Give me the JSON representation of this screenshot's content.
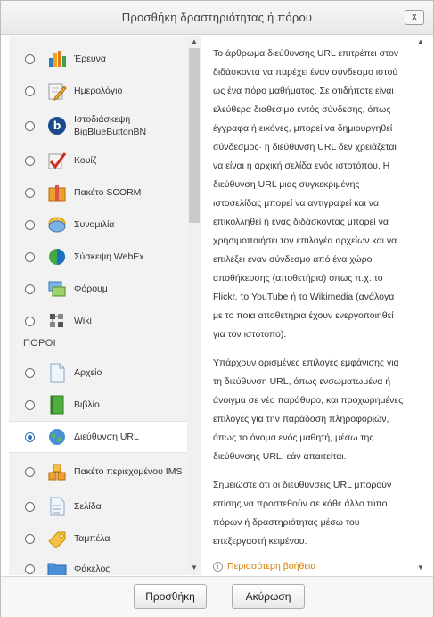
{
  "dialog": {
    "title": "Προσθήκη δραστηριότητας ή πόρου",
    "close_label": "x"
  },
  "activities": [
    {
      "label": "Έρευνα",
      "icon": "bar-chart-icon",
      "selected": false
    },
    {
      "label": "Ημερολόγιο",
      "icon": "journal-pencil-icon",
      "selected": false
    },
    {
      "label": "Ιστοδιάσκεψη BigBlueButtonBN",
      "icon": "bigbluebutton-icon",
      "selected": false
    },
    {
      "label": "Κουίζ",
      "icon": "quiz-checkmark-icon",
      "selected": false
    },
    {
      "label": "Πακέτο SCORM",
      "icon": "scorm-package-icon",
      "selected": false
    },
    {
      "label": "Συνομιλία",
      "icon": "chat-bubble-icon",
      "selected": false
    },
    {
      "label": "Σύσκεψη WebEx",
      "icon": "webex-icon",
      "selected": false
    },
    {
      "label": "Φόρουμ",
      "icon": "forum-icon",
      "selected": false
    },
    {
      "label": "Wiki",
      "icon": "wiki-icon",
      "selected": false
    }
  ],
  "resources_heading": "ΠΟΡΟΙ",
  "resources": [
    {
      "label": "Αρχείο",
      "icon": "file-icon",
      "selected": false
    },
    {
      "label": "Βιβλίο",
      "icon": "book-icon",
      "selected": false
    },
    {
      "label": "Διεύθυνση URL",
      "icon": "url-globe-icon",
      "selected": true
    },
    {
      "label": "Πακέτο περιεχομένου IMS",
      "icon": "ims-package-icon",
      "selected": false
    },
    {
      "label": "Σελίδα",
      "icon": "page-icon",
      "selected": false
    },
    {
      "label": "Ταμπέλα",
      "icon": "label-tag-icon",
      "selected": false
    },
    {
      "label": "Φάκελος",
      "icon": "folder-icon",
      "selected": false
    }
  ],
  "description": {
    "paragraphs": [
      "Το άρθρωμα διεύθυνσης URL επιτρέπει στον διδάσκοντα να παρέχει έναν σύνδεσμο ιστού ως ένα πόρο μαθήματος. Σε οτιδήποτε είναι ελεύθερα διαθέσιμο εντός σύνδεσης, όπως έγγραφα ή εικόνες, μπορεί να δημιουργηθεί σύνδεσμος· η διεύθυνση URL δεν χρειάζεται να είναι η αρχική σελίδα ενός ιστοτόπου. Η διεύθυνση URL μιας συγκεκριμένης ιστοσελίδας μπορεί να αντιγραφεί και να επικολληθεί ή ένας διδάσκοντας μπορεί να χρησιμοποιήσει τον επιλογέα αρχείων και να επιλέξει έναν σύνδεσμο από ένα χώρο αποθήκευσης (αποθετήριο) όπως π.χ. το Flickr, το YouTube ή το Wikimedia (ανάλογα με το ποια αποθετήρια έχουν ενεργοποιηθεί για τον ιστότοπο).",
      "Υπάρχουν ορισμένες επιλογές εμφάνισης για τη διεύθυνση URL, όπως ενσωματωμένα ή άνοιγμα σε νέο παράθυρο, και προχωρημένες επιλογές για την παράδοση πληροφοριών, όπως το όνομα ενός μαθητή, μέσω της διεύθυνσης URL, εάν απαιτείται.",
      "Σημειώστε ότι οι διευθύνσεις URL μπορούν επίσης να προστεθούν σε κάθε άλλο τύπο πόρων ή δραστηριότητας μέσω του επεξεργαστή κειμένου."
    ],
    "help_link": "Περισσότερη βοήθεια"
  },
  "footer": {
    "add_label": "Προσθήκη",
    "cancel_label": "Ακύρωση"
  },
  "colors": {
    "selected_radio": "#2a6fb8",
    "help_link": "#d17e00",
    "list_background": "#f2f2f2"
  }
}
